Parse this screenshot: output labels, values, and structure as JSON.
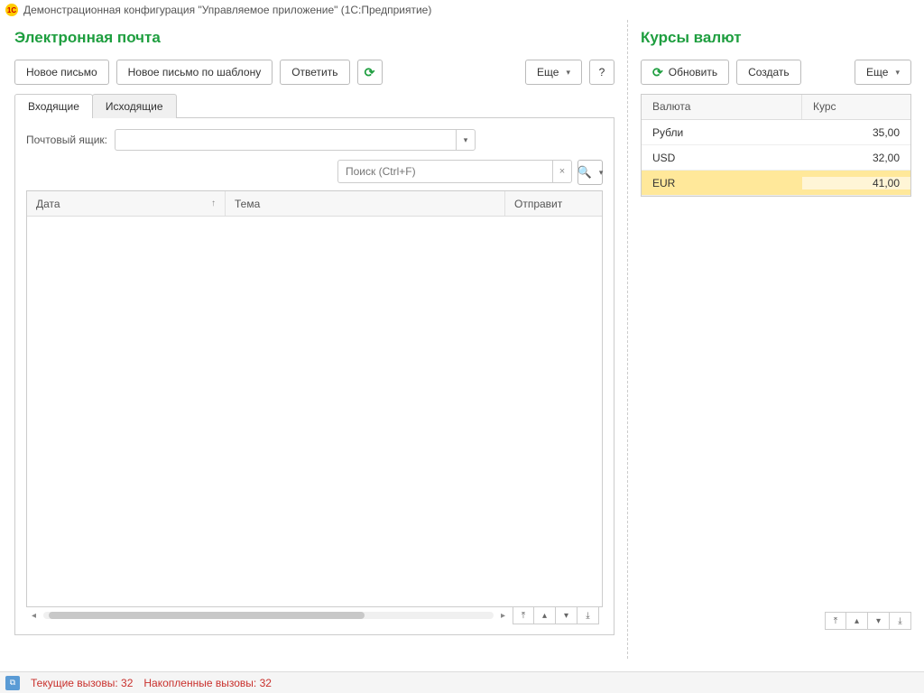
{
  "titlebar": {
    "text": "Демонстрационная конфигурация \"Управляемое приложение\"  (1С:Предприятие)",
    "icon_label": "1C"
  },
  "email_panel": {
    "title": "Электронная почта",
    "buttons": {
      "new_message": "Новое письмо",
      "new_from_template": "Новое письмо по шаблону",
      "reply": "Ответить",
      "more": "Еще",
      "help": "?"
    },
    "tabs": {
      "inbox": "Входящие",
      "outbox": "Исходящие"
    },
    "mailbox_label": "Почтовый ящик:",
    "search_placeholder": "Поиск (Ctrl+F)",
    "columns": {
      "date": "Дата",
      "subject": "Тема",
      "sender": "Отправит"
    }
  },
  "rates_panel": {
    "title": "Курсы валют",
    "buttons": {
      "refresh": "Обновить",
      "create": "Создать",
      "more": "Еще"
    },
    "columns": {
      "currency": "Валюта",
      "rate": "Курс"
    },
    "rows": [
      {
        "currency": "Рубли",
        "rate": "35,00",
        "selected": false
      },
      {
        "currency": "USD",
        "rate": "32,00",
        "selected": false
      },
      {
        "currency": "EUR",
        "rate": "41,00",
        "selected": true
      }
    ]
  },
  "status": {
    "current_calls_label": "Текущие вызовы:",
    "current_calls": "32",
    "accumulated_calls_label": "Накопленные вызовы:",
    "accumulated_calls": "32"
  }
}
